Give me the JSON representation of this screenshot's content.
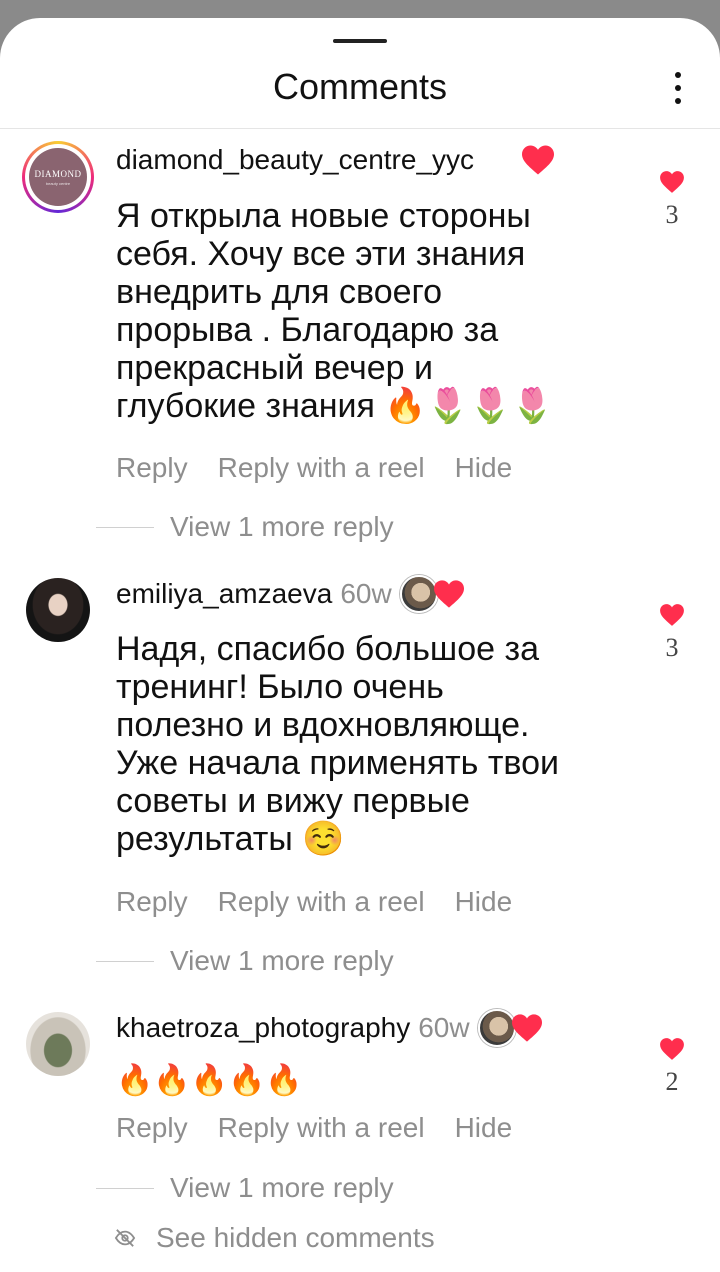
{
  "header": {
    "title": "Comments"
  },
  "comments": [
    {
      "username": "diamond_beauty_centre_yyc",
      "age": "",
      "avatar_text": "DIAMOND",
      "avatar_subtext": "beauty centre",
      "text": "Я открыла новые стороны\nсебя. Хочу все эти знания\nвнедрить для своего\nпрорыва . Благодарю за\nпрекрасный вечер и\nглубокие знания 🔥🌷🌷🌷",
      "like_count": "3",
      "actions": [
        "Reply",
        "Reply with a reel",
        "Hide"
      ],
      "more": "View 1 more reply"
    },
    {
      "username": "emiliya_amzaeva",
      "age": "60w",
      "text": "Надя, спасибо большое за\nтренинг! Было очень\nполезно и вдохновляюще.\nУже начала применять твои\nсоветы и вижу первые\nрезультаты ☺️",
      "like_count": "3",
      "actions": [
        "Reply",
        "Reply with a reel",
        "Hide"
      ],
      "more": "View 1 more reply"
    },
    {
      "username": "khaetroza_photography",
      "age": "60w",
      "text": "🔥🔥🔥🔥🔥",
      "like_count": "2",
      "actions": [
        "Reply",
        "Reply with a reel",
        "Hide"
      ],
      "more": "View 1 more reply"
    }
  ],
  "footer": {
    "hidden_label": "See hidden comments"
  },
  "colors": {
    "heart": "#ff2e4d",
    "muted": "#8e8e8e"
  }
}
